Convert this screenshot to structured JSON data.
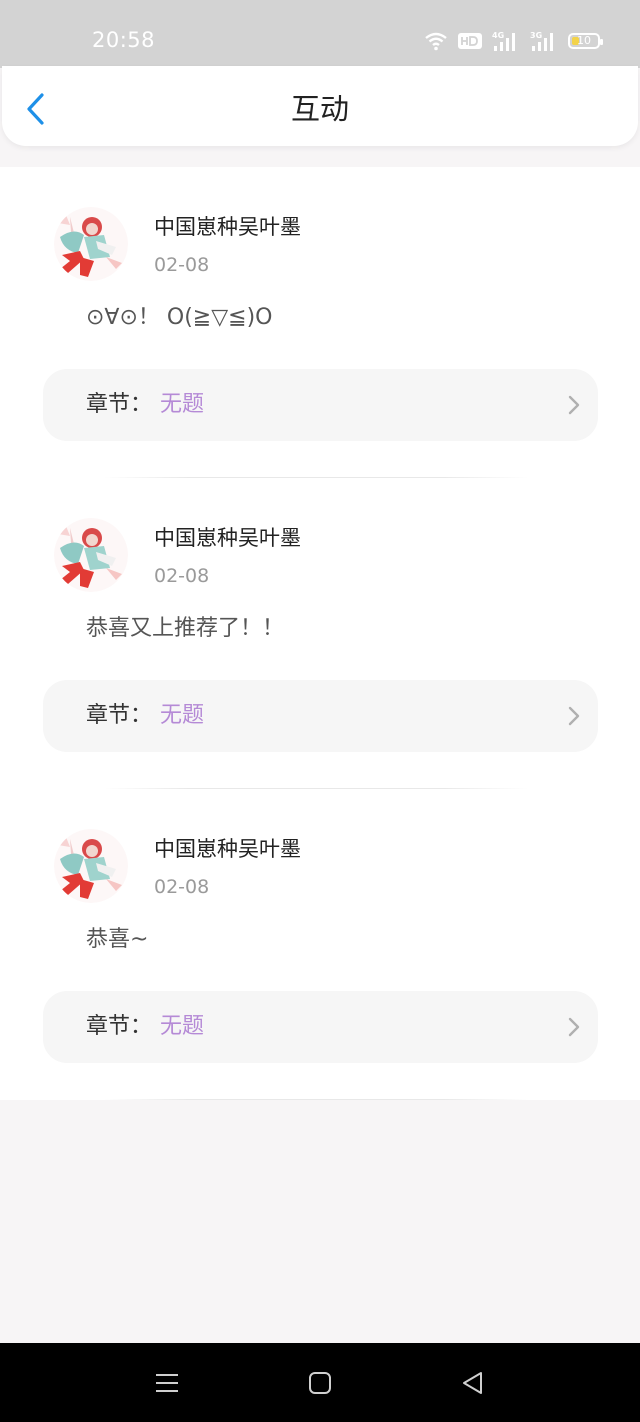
{
  "status_bar": {
    "time": "20:58",
    "battery_level": "10",
    "battery_color": "#f3d34a",
    "icons": [
      "wifi-icon",
      "hd-icon",
      "signal-4g-icon",
      "signal-3g-icon",
      "battery-icon"
    ]
  },
  "header": {
    "title": "互动",
    "back_icon": "chevron-left-icon",
    "accent_color": "#1e90e8"
  },
  "comments": [
    {
      "username": "中国崽种吴叶墨",
      "date": "02-08",
      "text": "⊙∀⊙！ O(≧▽≦)O",
      "chapter_label": "章节：",
      "chapter_name": "无题"
    },
    {
      "username": "中国崽种吴叶墨",
      "date": "02-08",
      "text": "恭喜又上推荐了！！",
      "chapter_label": "章节：",
      "chapter_name": "无题"
    },
    {
      "username": "中国崽种吴叶墨",
      "date": "02-08",
      "text": "恭喜~",
      "chapter_label": "章节：",
      "chapter_name": "无题"
    }
  ],
  "colors": {
    "chapter_name": "#b58ad6",
    "date": "#9a9a9a"
  },
  "nav_bar": {
    "icons": [
      "menu-icon",
      "home-icon",
      "back-triangle-icon"
    ]
  }
}
